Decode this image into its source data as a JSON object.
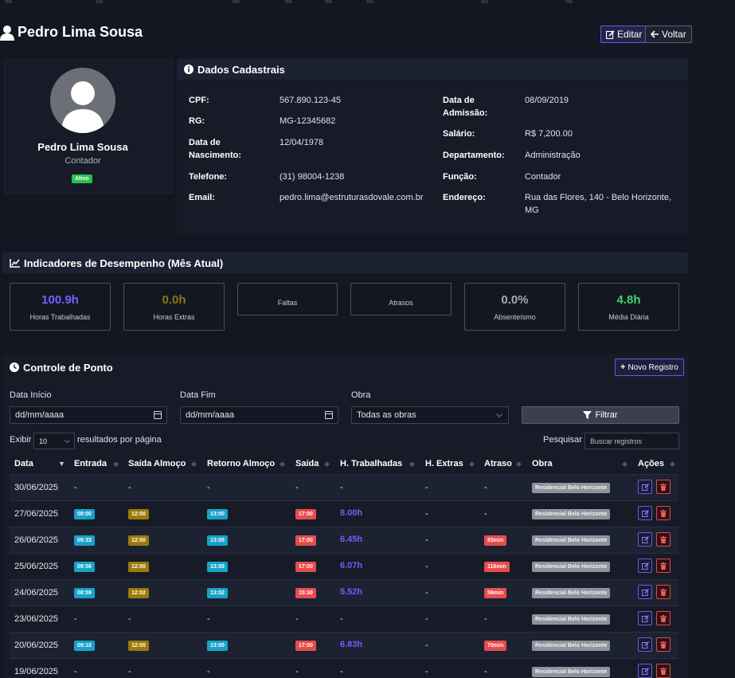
{
  "colors": {
    "accent": "#6a5ae0",
    "background": "#121722",
    "panel": "#1c2231",
    "success": "#27c24c",
    "danger": "#e74c4c",
    "info": "#17a2c8",
    "warning": "#9c7a0a"
  },
  "header": {
    "title": "Pedro Lima Sousa",
    "edit_label": "Editar",
    "back_label": "Voltar"
  },
  "profile": {
    "name": "Pedro Lima Sousa",
    "role": "Contador",
    "status": "Ativo"
  },
  "dados": {
    "title": "Dados Cadastrais",
    "left": [
      {
        "label": "CPF:",
        "value": "567.890.123-45"
      },
      {
        "label": "RG:",
        "value": "MG-12345682"
      },
      {
        "label": "Data de Nascimento:",
        "value": "12/04/1978"
      },
      {
        "label": "Telefone:",
        "value": "(31) 98004-1238"
      },
      {
        "label": "Email:",
        "value": "pedro.lima@estruturasdovale.com.br"
      }
    ],
    "right": [
      {
        "label": "Data de Admissão:",
        "value": "08/09/2019"
      },
      {
        "label": "Salário:",
        "value": "R$ 7,200.00"
      },
      {
        "label": "Departamento:",
        "value": "Administração"
      },
      {
        "label": "Função:",
        "value": "Contador"
      },
      {
        "label": "Endereço:",
        "value": "Rua das Flores, 140 - Belo Horizonte, MG"
      }
    ]
  },
  "indicadores": {
    "title": "Indicadores de Desempenho (Mês Atual)",
    "kpis": [
      {
        "value": "100.9h",
        "label": "Horas Trabalhadas",
        "color": "#7a5cff"
      },
      {
        "value": "0.0h",
        "label": "Horas Extras",
        "color": "#8f7412"
      },
      {
        "value": "",
        "label": "Faltas",
        "color": "#ffffff"
      },
      {
        "value": "",
        "label": "Atrasos",
        "color": "#ffffff"
      },
      {
        "value": "0.0%",
        "label": "Absenteísmo",
        "color": "#a4a9b4"
      },
      {
        "value": "4.8h",
        "label": "Média Diária",
        "color": "#3fd46a"
      }
    ]
  },
  "ponto": {
    "title": "Controle de Ponto",
    "novo_label": "Novo Registro",
    "filters": {
      "data_inicio_label": "Data Início",
      "data_inicio_value": "dd/mm/aaaa",
      "data_fim_label": "Data Fim",
      "data_fim_value": "dd/mm/aaaa",
      "obra_label": "Obra",
      "obra_value": "Todas as obras",
      "filtrar_label": "Filtrar"
    },
    "exibir_label": "Exibir",
    "page_size": "10",
    "per_page_label": "resultados por página",
    "search_label": "Pesquisar",
    "search_placeholder": "Buscar registros",
    "columns": [
      "Data",
      "Entrada",
      "Saída Almoço",
      "Retorno Almoço",
      "Saída",
      "H. Trabalhadas",
      "H. Extras",
      "Atraso",
      "Obra",
      "Ações"
    ],
    "rows": [
      {
        "data": "30/06/2025",
        "entrada": "-",
        "saida_almoco": "-",
        "retorno": "-",
        "saida": "-",
        "horas": "-",
        "extras": "-",
        "atraso": "-",
        "obra": "Residencial Belo Horizonte"
      },
      {
        "data": "27/06/2025",
        "entrada": "08:00",
        "saida_almoco": "12:00",
        "retorno": "13:00",
        "saida": "17:00",
        "horas": "8.00h",
        "extras": "-",
        "atraso": "-",
        "obra": "Residencial Belo Horizonte"
      },
      {
        "data": "26/06/2025",
        "entrada": "09:33",
        "saida_almoco": "12:00",
        "retorno": "13:00",
        "saida": "17:00",
        "horas": "6.45h",
        "extras": "-",
        "atraso": "93min",
        "obra": "Residencial Belo Horizonte"
      },
      {
        "data": "25/06/2025",
        "entrada": "09:56",
        "saida_almoco": "12:00",
        "retorno": "13:00",
        "saida": "17:00",
        "horas": "6.07h",
        "extras": "-",
        "atraso": "116min",
        "obra": "Residencial Belo Horizonte"
      },
      {
        "data": "24/06/2025",
        "entrada": "08:59",
        "saida_almoco": "12:02",
        "retorno": "13:02",
        "saida": "15:30",
        "horas": "5.52h",
        "extras": "-",
        "atraso": "59min",
        "obra": "Residencial Belo Horizonte"
      },
      {
        "data": "23/06/2025",
        "entrada": "-",
        "saida_almoco": "-",
        "retorno": "-",
        "saida": "-",
        "horas": "-",
        "extras": "-",
        "atraso": "-",
        "obra": "Residencial Belo Horizonte"
      },
      {
        "data": "20/06/2025",
        "entrada": "09:10",
        "saida_almoco": "12:00",
        "retorno": "13:00",
        "saida": "17:00",
        "horas": "6.83h",
        "extras": "-",
        "atraso": "70min",
        "obra": "Residencial Belo Horizonte"
      },
      {
        "data": "19/06/2025",
        "entrada": "-",
        "saida_almoco": "-",
        "retorno": "-",
        "saida": "-",
        "horas": "-",
        "extras": "-",
        "atraso": "-",
        "obra": "Residencial Belo Horizonte"
      }
    ]
  }
}
